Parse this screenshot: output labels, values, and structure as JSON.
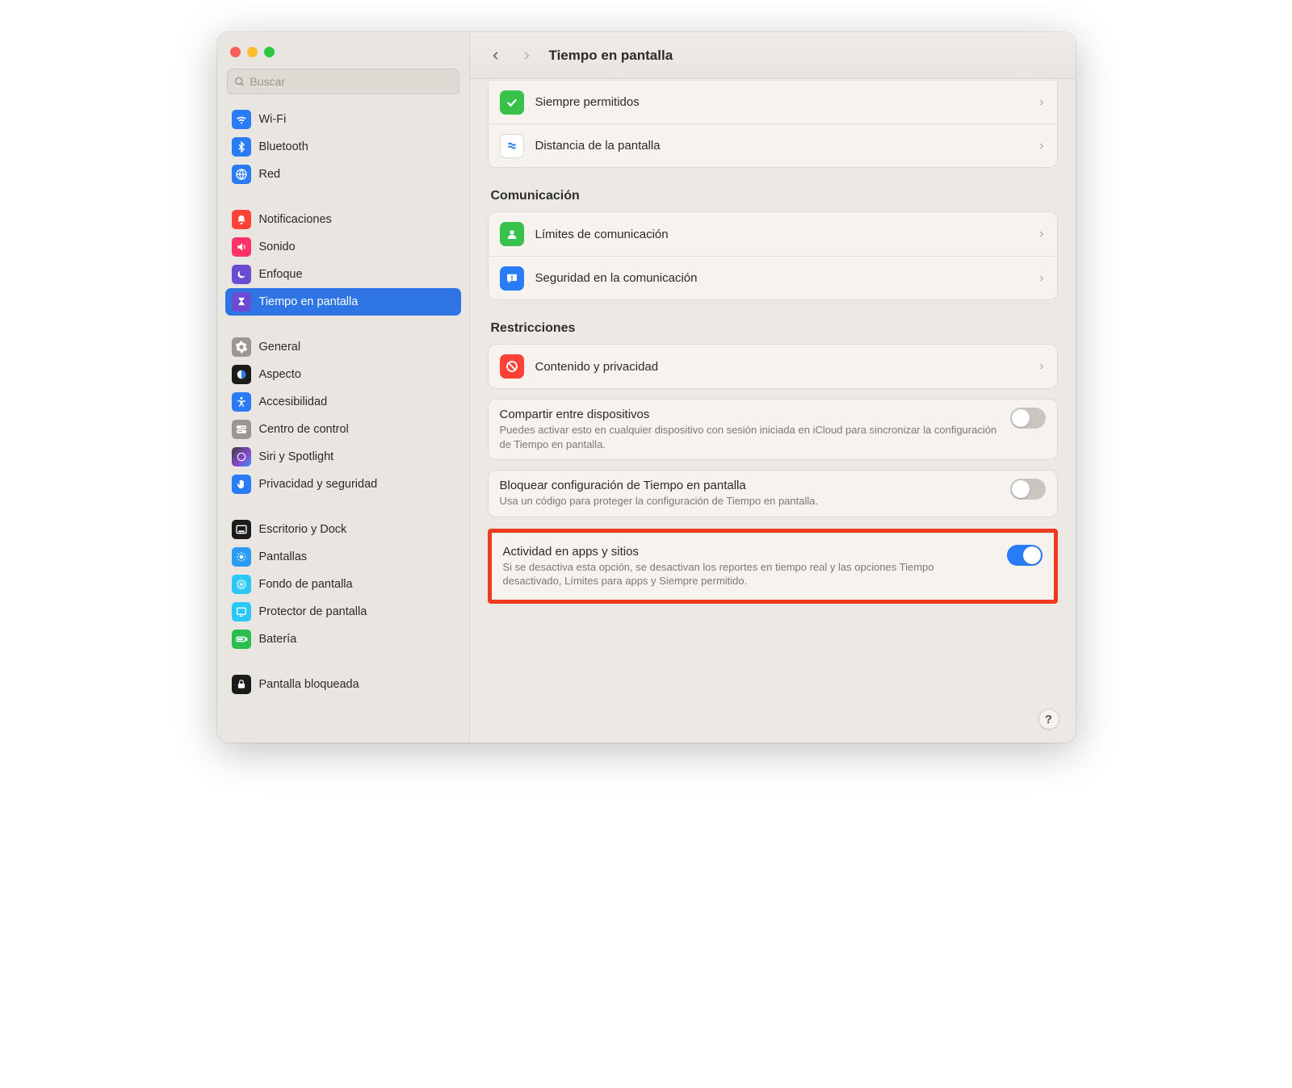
{
  "search": {
    "placeholder": "Buscar"
  },
  "header": {
    "title": "Tiempo en pantalla"
  },
  "sidebar": {
    "items": [
      {
        "label": "Wi-Fi",
        "icon": "wifi-icon"
      },
      {
        "label": "Bluetooth",
        "icon": "bluetooth-icon"
      },
      {
        "label": "Red",
        "icon": "globe-icon"
      },
      {
        "label": "Notificaciones",
        "icon": "bell-icon"
      },
      {
        "label": "Sonido",
        "icon": "speaker-icon"
      },
      {
        "label": "Enfoque",
        "icon": "moon-icon"
      },
      {
        "label": "Tiempo en pantalla",
        "icon": "hourglass-icon",
        "selected": true
      },
      {
        "label": "General",
        "icon": "gear-icon"
      },
      {
        "label": "Aspecto",
        "icon": "appearance-icon"
      },
      {
        "label": "Accesibilidad",
        "icon": "accessibility-icon"
      },
      {
        "label": "Centro de control",
        "icon": "switches-icon"
      },
      {
        "label": "Siri y Spotlight",
        "icon": "siri-icon"
      },
      {
        "label": "Privacidad y seguridad",
        "icon": "hand-icon"
      },
      {
        "label": "Escritorio y Dock",
        "icon": "dock-icon"
      },
      {
        "label": "Pantallas",
        "icon": "display-icon"
      },
      {
        "label": "Fondo de pantalla",
        "icon": "wallpaper-icon"
      },
      {
        "label": "Protector de pantalla",
        "icon": "screensaver-icon"
      },
      {
        "label": "Batería",
        "icon": "battery-icon"
      },
      {
        "label": "Pantalla bloqueada",
        "icon": "lock-icon"
      }
    ]
  },
  "main": {
    "group1": {
      "always_allowed": "Siempre permitidos",
      "screen_distance": "Distancia de la pantalla"
    },
    "comunicacion": {
      "title": "Comunicación",
      "limits": "Límites de comunicación",
      "safety": "Seguridad en la comunicación"
    },
    "restricciones": {
      "title": "Restricciones",
      "content_privacy": "Contenido y privacidad"
    },
    "share": {
      "title": "Compartir entre dispositivos",
      "desc": "Puedes activar esto en cualquier dispositivo con sesión iniciada en iCloud para sincronizar la configuración de Tiempo en pantalla.",
      "on": false
    },
    "lock": {
      "title": "Bloquear configuración de Tiempo en pantalla",
      "desc": "Usa un código para proteger la configuración de Tiempo en pantalla.",
      "on": false
    },
    "activity": {
      "title": "Actividad en apps y sitios",
      "desc": "Si se desactiva esta opción, se desactivan los reportes en tiempo real y las opciones Tiempo desactivado, Límites para apps y Siempre permitido.",
      "on": true
    }
  }
}
